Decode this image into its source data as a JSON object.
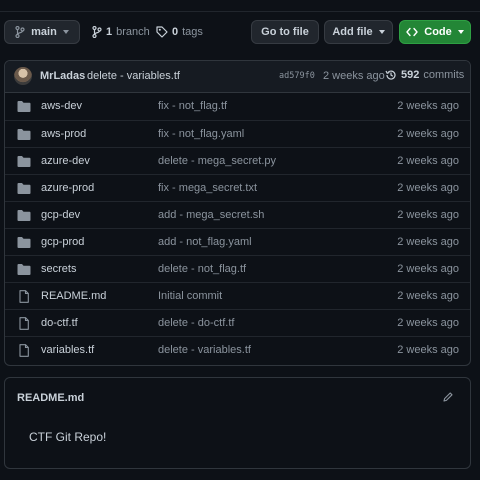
{
  "toolbar": {
    "branch_button": {
      "label": "main",
      "icon": "git-branch-icon"
    },
    "branches": {
      "count": "1",
      "label": "branch",
      "icon": "git-branch-icon"
    },
    "tags": {
      "count": "0",
      "label": "tags",
      "icon": "tag-icon"
    },
    "go_to_file": "Go to file",
    "add_file": "Add file",
    "code": {
      "label": "Code",
      "icon": "code-icon"
    }
  },
  "latest_commit": {
    "author": "MrLadas",
    "message": "delete - variables.tf",
    "sha": "ad579f0",
    "time": "2 weeks ago",
    "commits_count": "592",
    "commits_label": "commits"
  },
  "files": [
    {
      "type": "dir",
      "name": "aws-dev",
      "commit": "fix - not_flag.tf",
      "age": "2 weeks ago"
    },
    {
      "type": "dir",
      "name": "aws-prod",
      "commit": "fix - not_flag.yaml",
      "age": "2 weeks ago"
    },
    {
      "type": "dir",
      "name": "azure-dev",
      "commit": "delete - mega_secret.py",
      "age": "2 weeks ago"
    },
    {
      "type": "dir",
      "name": "azure-prod",
      "commit": "fix - mega_secret.txt",
      "age": "2 weeks ago"
    },
    {
      "type": "dir",
      "name": "gcp-dev",
      "commit": "add - mega_secret.sh",
      "age": "2 weeks ago"
    },
    {
      "type": "dir",
      "name": "gcp-prod",
      "commit": "add - not_flag.yaml",
      "age": "2 weeks ago"
    },
    {
      "type": "dir",
      "name": "secrets",
      "commit": "delete - not_flag.tf",
      "age": "2 weeks ago"
    },
    {
      "type": "file",
      "name": "README.md",
      "commit": "Initial commit",
      "age": "2 weeks ago"
    },
    {
      "type": "file",
      "name": "do-ctf.tf",
      "commit": "delete - do-ctf.tf",
      "age": "2 weeks ago"
    },
    {
      "type": "file",
      "name": "variables.tf",
      "commit": "delete - variables.tf",
      "age": "2 weeks ago"
    }
  ],
  "readme": {
    "title": "README.md",
    "body": "CTF Git Repo!"
  },
  "colors": {
    "background": "#0d1117",
    "border": "#30363d",
    "code_button": "#238636",
    "folder_icon": "#8b949e",
    "muted_text": "#8b949e"
  }
}
